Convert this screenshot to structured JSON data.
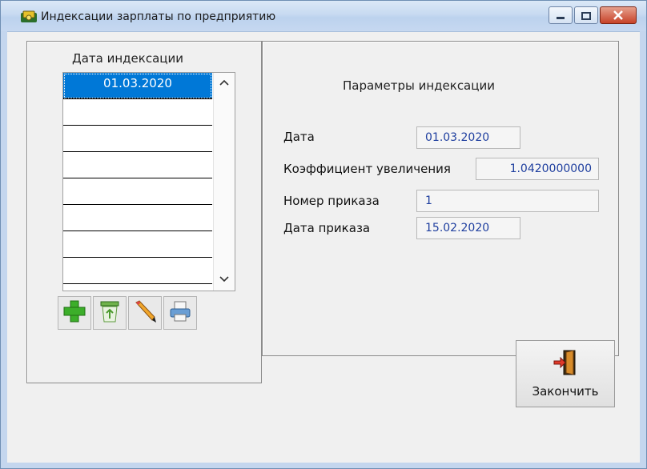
{
  "window": {
    "title": "Индексации зарплаты по предприятию",
    "icons": [
      "app-icon",
      "minimize-icon",
      "maximize-icon",
      "close-icon"
    ]
  },
  "left_panel": {
    "title": "Дата индексации",
    "list": {
      "items": [
        "01.03.2020",
        "",
        "",
        "",
        "",
        "",
        "",
        ""
      ],
      "selected_index": 0
    },
    "toolbar": {
      "buttons": [
        {
          "icon": "add-icon"
        },
        {
          "icon": "delete-icon"
        },
        {
          "icon": "edit-icon"
        },
        {
          "icon": "print-icon"
        }
      ]
    }
  },
  "right_panel": {
    "title": "Параметры индексации",
    "fields": {
      "date": {
        "label": "Дата",
        "value": "01.03.2020"
      },
      "coefficient": {
        "label": "Коэффициент увеличения",
        "value": "1.0420000000"
      },
      "order_number": {
        "label": "Номер приказа",
        "value": "1"
      },
      "order_date": {
        "label": "Дата приказа",
        "value": "15.02.2020"
      }
    }
  },
  "finish_button": {
    "label": "Закончить",
    "icon": "exit-door-icon"
  },
  "colors": {
    "selection": "#0078d7",
    "field_text": "#1f3f9f",
    "close_button": "#c74228"
  }
}
